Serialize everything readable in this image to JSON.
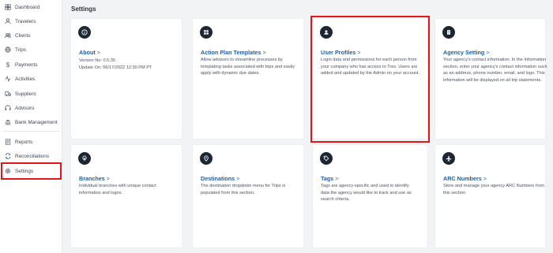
{
  "page_title": "Settings",
  "sidebar": {
    "items": [
      {
        "label": "Dashboard",
        "icon": "dashboard-icon"
      },
      {
        "label": "Travelers",
        "icon": "travelers-icon"
      },
      {
        "label": "Clients",
        "icon": "clients-icon"
      },
      {
        "label": "Trips",
        "icon": "trips-icon"
      },
      {
        "label": "Payments",
        "icon": "payments-icon"
      },
      {
        "label": "Activities",
        "icon": "activities-icon"
      },
      {
        "label": "Suppliers",
        "icon": "suppliers-icon"
      },
      {
        "label": "Advisors",
        "icon": "advisors-icon"
      },
      {
        "label": "Bank Management",
        "icon": "bank-icon"
      },
      {
        "label": "Reports",
        "icon": "reports-icon"
      },
      {
        "label": "Reconciliations",
        "icon": "reconciliations-icon"
      },
      {
        "label": "Settings",
        "icon": "gear-icon",
        "active": true
      }
    ]
  },
  "cards": {
    "about": {
      "title": "About",
      "line1": "Version No: 0.5.35",
      "line2": "Update On: 06/17/2022 12:30 PM PT",
      "icon": "info-icon"
    },
    "action_plan": {
      "title": "Action Plan Templates",
      "desc": "Allow advisors to streamline processes by templating tasks associated with trips and easily apply with dynamic due dates.",
      "icon": "grid-icon"
    },
    "user_profiles": {
      "title": "User Profiles",
      "desc": "Login data and permissions for each person from your company who has access to Tres. Users are added and updated by the Admin on your account.",
      "icon": "user-icon"
    },
    "agency_setting": {
      "title": "Agency Setting",
      "desc": "Your agency's contact information. In the Information section, enter your agency's contact information such as an address, phone number, email, and logo. This information will be displayed on all trip statements.",
      "icon": "building-icon"
    },
    "branches": {
      "title": "Branches",
      "desc": "Individual branches with unique contact information and logos.",
      "icon": "tree-icon"
    },
    "destinations": {
      "title": "Destinations",
      "desc": "The destination dropdown menu for Trips is populated from this section.",
      "icon": "location-pin-icon"
    },
    "tags": {
      "title": "Tags",
      "desc": "Tags are agency-specific and used to identify data the agency would like to track and use as search criteria.",
      "icon": "tag-icon"
    },
    "arc_numbers": {
      "title": "ARC Numbers",
      "desc": "Store and manage your agency ARC Numbers from this section",
      "icon": "airplane-icon"
    }
  },
  "chevron": ">",
  "colors": {
    "accent": "#1f5fa3",
    "highlight": "#e3151b",
    "badge": "#1d2733"
  }
}
